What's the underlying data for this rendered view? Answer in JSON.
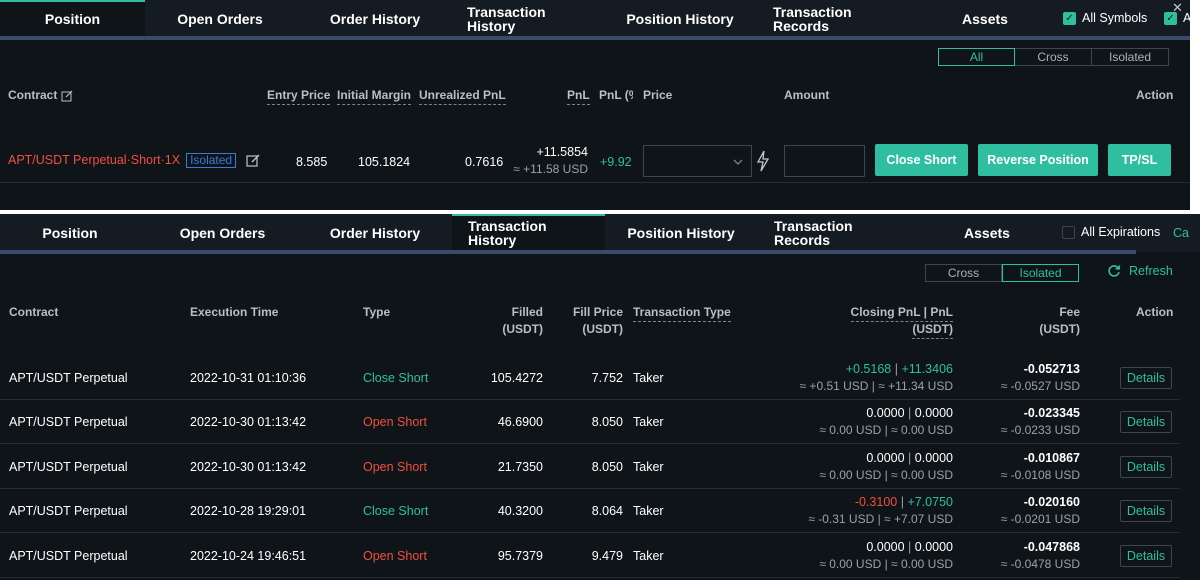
{
  "tabs": [
    "Position",
    "Open Orders",
    "Order History",
    "Transaction History",
    "Position History",
    "Transaction Records",
    "Assets"
  ],
  "panel1": {
    "active_tab": "Position",
    "all_symbols_label": "All Symbols",
    "extra_check_label": "A",
    "filters": [
      "All",
      "Cross",
      "Isolated"
    ],
    "active_filter": "All",
    "headers": {
      "contract": "Contract",
      "entry_price": "Entry Price",
      "initial_margin": "Initial Margin",
      "unrealized_pnl": "Unrealized PnL",
      "pnl": "PnL",
      "pnl_pct": "PnL (%",
      "price": "Price",
      "amount": "Amount",
      "action": "Action"
    },
    "position": {
      "contract": "APT/USDT Perpetual·Short·1X",
      "margin_mode": "Isolated",
      "entry_price": "8.585",
      "initial_margin": "105.1824",
      "unrealized_pnl": "0.7616",
      "pnl": "+11.5854",
      "pnl_usd": "≈ +11.58 USD",
      "pnl_pct": "+9.92",
      "close_label": "Close Short",
      "reverse_label": "Reverse Position",
      "tpsl_label": "TP/SL"
    }
  },
  "panel2": {
    "active_tab": "Transaction History",
    "all_expirations_label": "All Expirations",
    "extra_label": "Ca",
    "filters": [
      "Cross",
      "Isolated"
    ],
    "active_filter": "Isolated",
    "refresh_label": "Refresh",
    "headers": {
      "contract": "Contract",
      "execution_time": "Execution Time",
      "type": "Type",
      "filled": "Filled",
      "filled_unit": "(USDT)",
      "fill_price": "Fill Price",
      "fill_price_unit": "(USDT)",
      "transaction_type": "Transaction Type",
      "closing_pnl": "Closing PnL | PnL",
      "closing_pnl_unit": "(USDT)",
      "fee": "Fee",
      "fee_unit": "(USDT)",
      "action": "Action"
    },
    "details_label": "Details",
    "rows": [
      {
        "contract": "APT/USDT Perpetual",
        "time": "2022-10-31 01:10:36",
        "type": "Close Short",
        "filled": "105.4272",
        "fill_price": "7.752",
        "tx_type": "Taker",
        "pnl_a": "+0.5168",
        "pnl_b": "+11.3406",
        "pnl_usd": "≈ +0.51 USD | ≈ +11.34 USD",
        "fee": "-0.052713",
        "fee_usd": "≈ -0.0527 USD"
      },
      {
        "contract": "APT/USDT Perpetual",
        "time": "2022-10-30 01:13:42",
        "type": "Open Short",
        "filled": "46.6900",
        "fill_price": "8.050",
        "tx_type": "Taker",
        "pnl_a": "0.0000",
        "pnl_b": "0.0000",
        "pnl_usd": "≈ 0.00 USD | ≈ 0.00 USD",
        "fee": "-0.023345",
        "fee_usd": "≈ -0.0233 USD"
      },
      {
        "contract": "APT/USDT Perpetual",
        "time": "2022-10-30 01:13:42",
        "type": "Open Short",
        "filled": "21.7350",
        "fill_price": "8.050",
        "tx_type": "Taker",
        "pnl_a": "0.0000",
        "pnl_b": "0.0000",
        "pnl_usd": "≈ 0.00 USD | ≈ 0.00 USD",
        "fee": "-0.010867",
        "fee_usd": "≈ -0.0108 USD"
      },
      {
        "contract": "APT/USDT Perpetual",
        "time": "2022-10-28 19:29:01",
        "type": "Close Short",
        "filled": "40.3200",
        "fill_price": "8.064",
        "tx_type": "Taker",
        "pnl_a": "-0.3100",
        "pnl_b": "+7.0750",
        "pnl_usd": "≈ -0.31 USD | ≈ +7.07 USD",
        "fee": "-0.020160",
        "fee_usd": "≈ -0.0201 USD"
      },
      {
        "contract": "APT/USDT Perpetual",
        "time": "2022-10-24 19:46:51",
        "type": "Open Short",
        "filled": "95.7379",
        "fill_price": "9.479",
        "tx_type": "Taker",
        "pnl_a": "0.0000",
        "pnl_b": "0.0000",
        "pnl_usd": "≈ 0.00 USD | ≈ 0.00 USD",
        "fee": "-0.047868",
        "fee_usd": "≈ -0.0478 USD"
      }
    ]
  },
  "colors": {
    "accent": "#2fbfa0",
    "loss": "#f0503c",
    "background": "#0f1419",
    "isolated_badge": "#3a7bd5"
  },
  "icons": [
    "edit-icon",
    "lightning-icon",
    "chevron-down-icon",
    "refresh-icon",
    "close-icon",
    "checkbox-icon"
  ]
}
